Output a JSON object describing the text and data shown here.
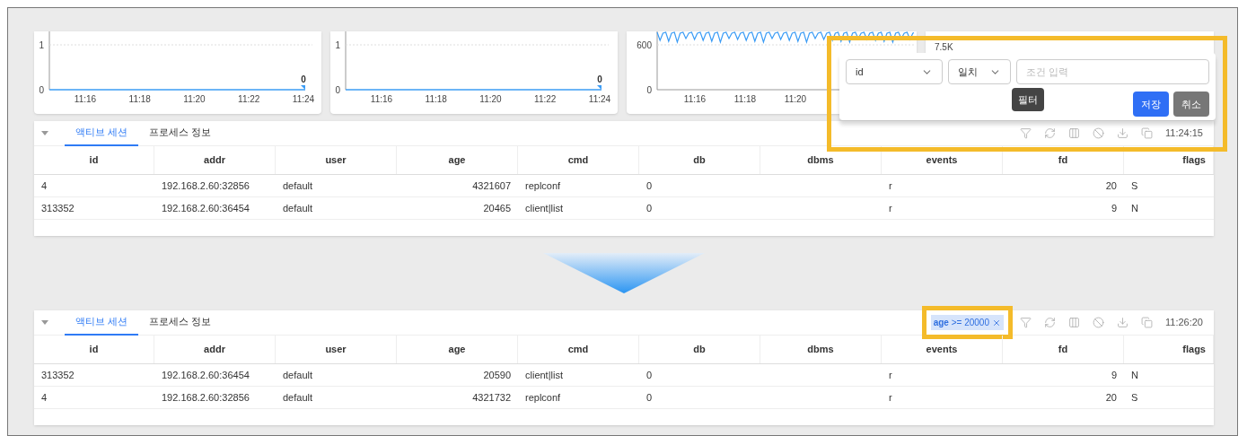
{
  "charts": [
    {
      "kind": "flat",
      "y_labels": [
        "1",
        "0"
      ],
      "x_labels": [
        "11:16",
        "11:18",
        "11:20",
        "11:22",
        "11:24"
      ],
      "last_value": "0"
    },
    {
      "kind": "flat",
      "y_labels": [
        "1",
        "0"
      ],
      "x_labels": [
        "11:16",
        "11:18",
        "11:20",
        "11:22",
        "11:24"
      ],
      "last_value": "0"
    },
    {
      "kind": "wave",
      "y_labels": [
        "600",
        "0"
      ],
      "x_labels": [
        "11:16",
        "11:18",
        "11:20"
      ]
    },
    {
      "kind": "peek",
      "label": "7.5K"
    }
  ],
  "filter_popover": {
    "field": "id",
    "operator": "일치",
    "placeholder": "조건 입력",
    "save": "저장",
    "cancel": "취소",
    "tooltip": "필터"
  },
  "panels": [
    {
      "tabs": [
        {
          "label": "액티브 세션",
          "selected": true
        },
        {
          "label": "프로세스 정보",
          "selected": false
        }
      ],
      "time": "11:24:15",
      "columns": [
        "id",
        "addr",
        "user",
        "age",
        "cmd",
        "db",
        "dbms",
        "events",
        "fd",
        "flags"
      ],
      "rows": [
        [
          "4",
          "192.168.2.60:32856",
          "default",
          "4321607",
          "replconf",
          "0",
          null,
          "r",
          "20",
          "S"
        ],
        [
          "313352",
          "192.168.2.60:36454",
          "default",
          "20465",
          "client|list",
          "0",
          null,
          "r",
          "9",
          "N"
        ]
      ]
    },
    {
      "tabs": [
        {
          "label": "액티브 세션",
          "selected": true
        },
        {
          "label": "프로세스 정보",
          "selected": false
        }
      ],
      "filter_chip": "**age** >= 20000",
      "time": "11:26:20",
      "columns": [
        "id",
        "addr",
        "user",
        "age",
        "cmd",
        "db",
        "dbms",
        "events",
        "fd",
        "flags"
      ],
      "rows": [
        [
          "313352",
          "192.168.2.60:36454",
          "default",
          "20590",
          "client|list",
          "0",
          null,
          "r",
          "9",
          "N"
        ],
        [
          "4",
          "192.168.2.60:32856",
          "default",
          "4321732",
          "replconf",
          "0",
          null,
          "r",
          "20",
          "S"
        ]
      ]
    }
  ]
}
